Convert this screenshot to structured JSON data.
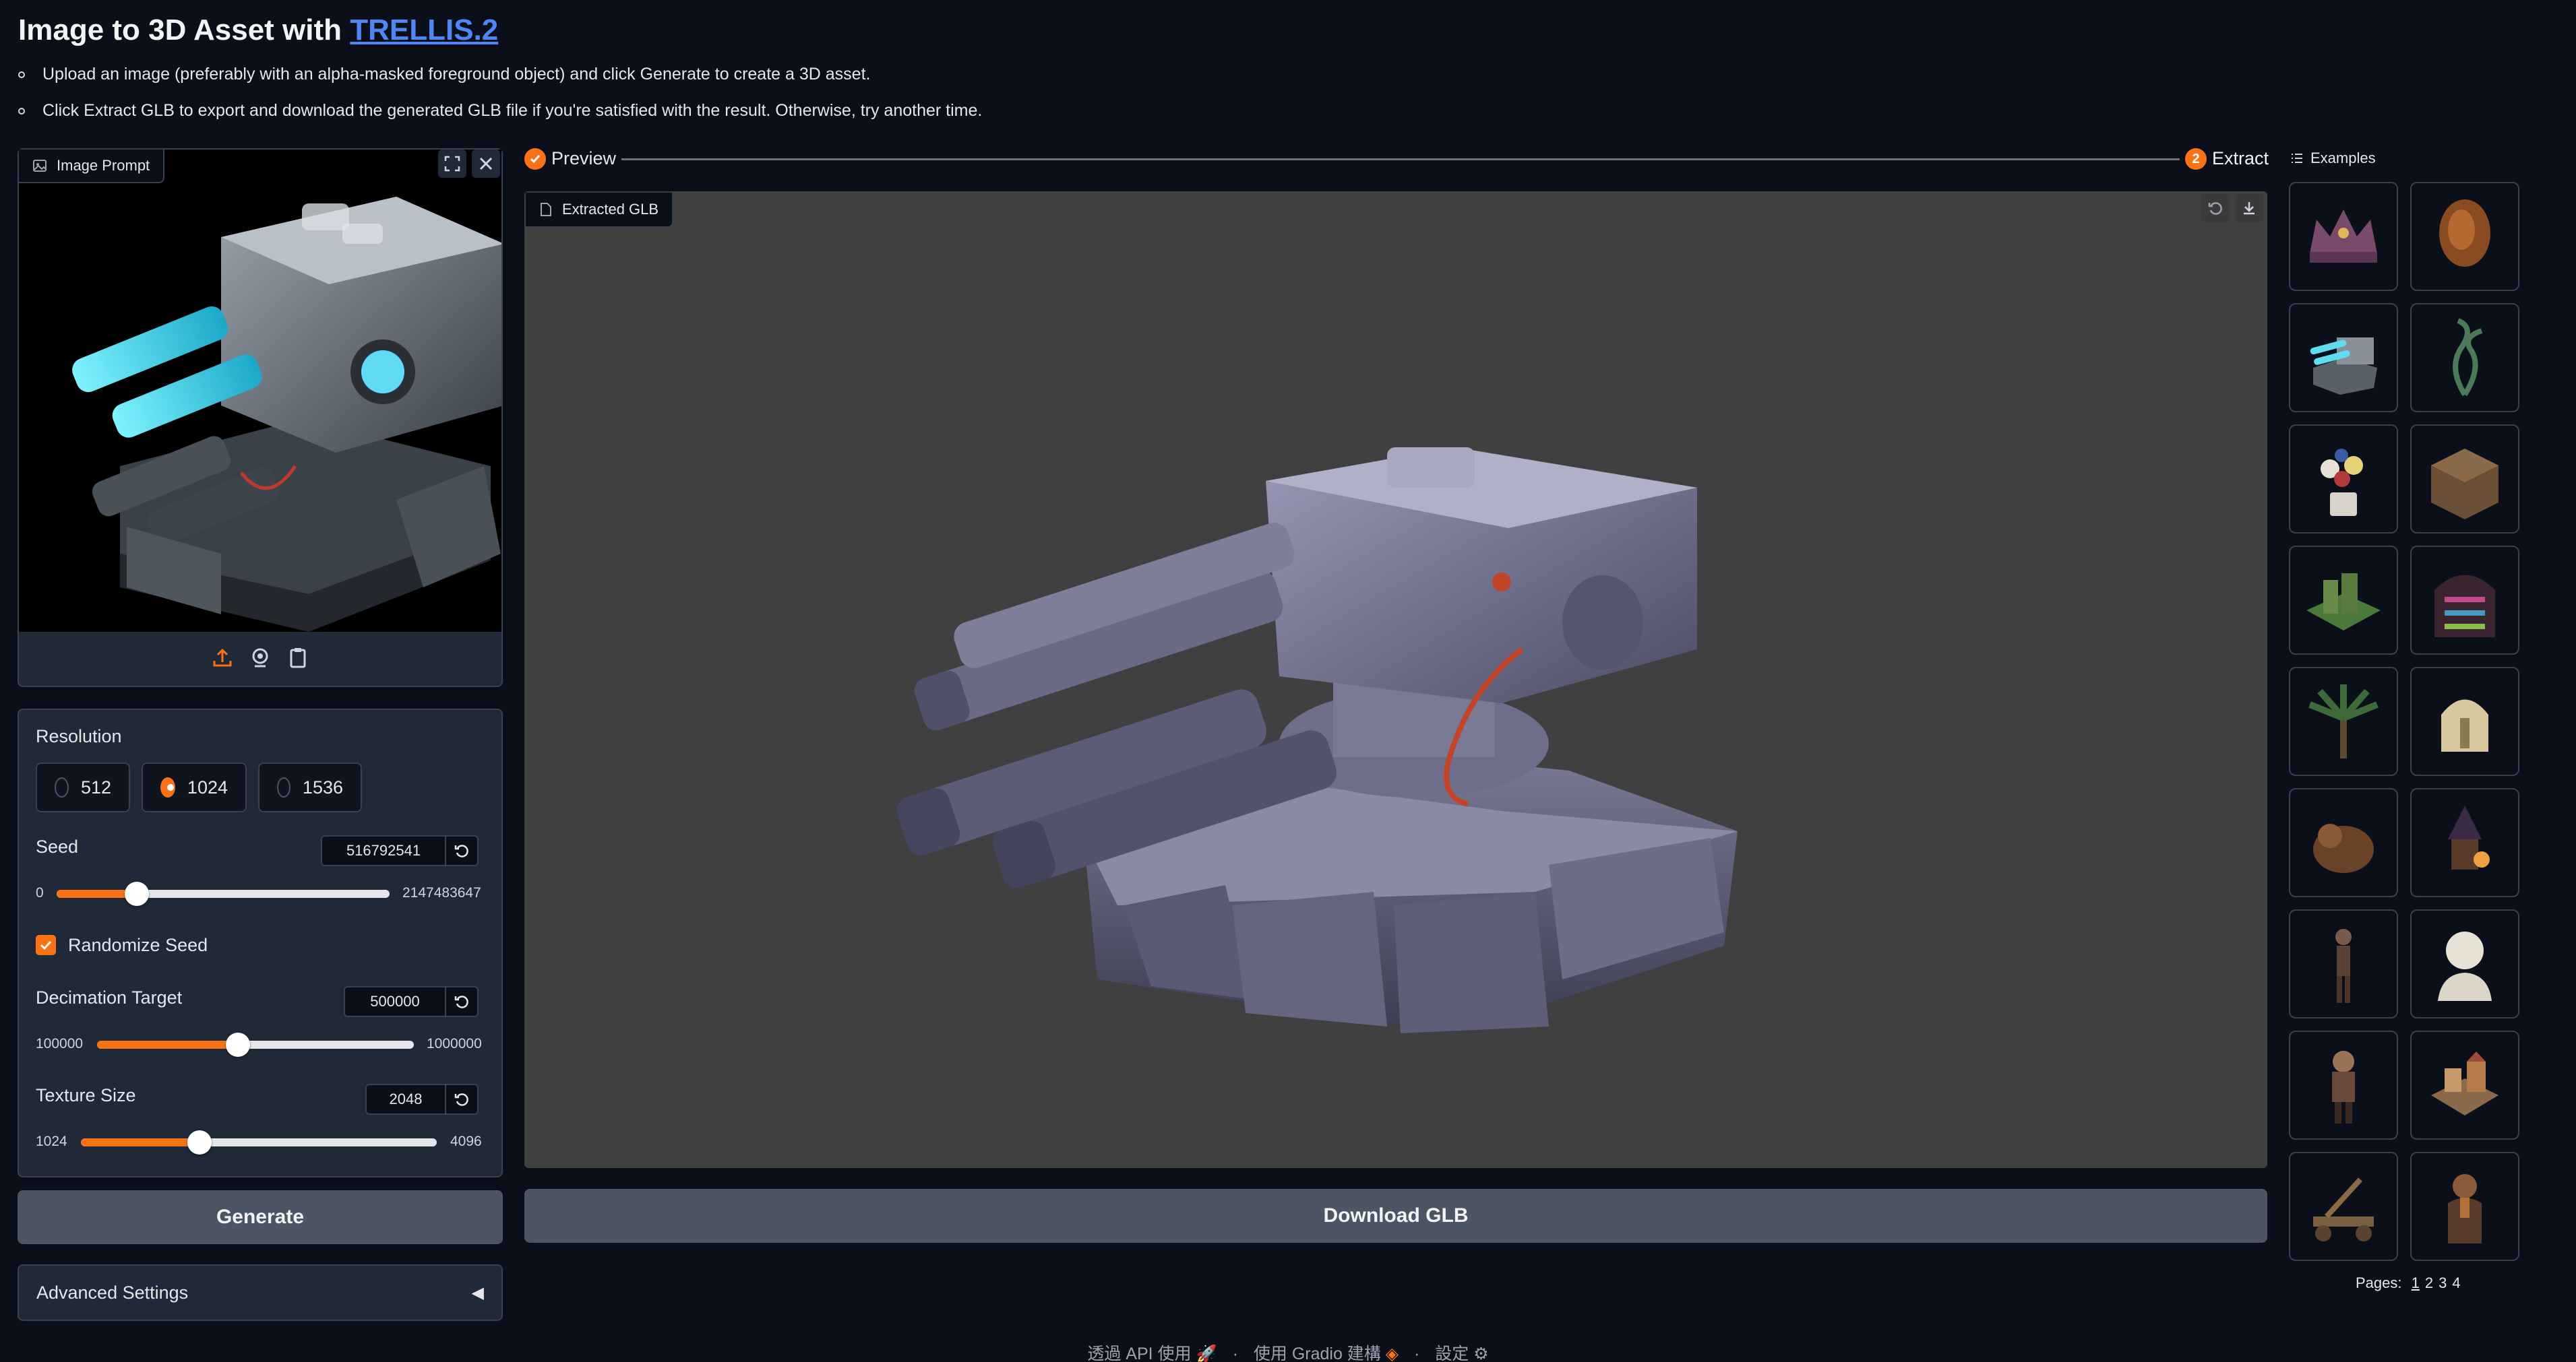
{
  "header": {
    "title_prefix": "Image to 3D Asset with ",
    "title_link": "TRELLIS.2",
    "bullets": [
      "Upload an image (preferably with an alpha-masked foreground object) and click Generate to create a 3D asset.",
      "Click Extract GLB to export and download the generated GLB file if you're satisfied with the result. Otherwise, try another time."
    ]
  },
  "image_prompt": {
    "label": "Image Prompt",
    "toolbar_icons": [
      "upload-icon",
      "webcam-icon",
      "clipboard-icon"
    ]
  },
  "resolution": {
    "label": "Resolution",
    "options": [
      "512",
      "1024",
      "1536"
    ],
    "selected": "1024"
  },
  "seed": {
    "label": "Seed",
    "value": "516792541",
    "min": "0",
    "max": "2147483647",
    "fraction": 0.24
  },
  "randomize_seed": {
    "label": "Randomize Seed",
    "checked": true
  },
  "decimation": {
    "label": "Decimation Target",
    "value": "500000",
    "min": "100000",
    "max": "1000000",
    "fraction": 0.444
  },
  "texture": {
    "label": "Texture Size",
    "value": "2048",
    "min": "1024",
    "max": "4096",
    "fraction": 0.333
  },
  "buttons": {
    "generate": "Generate",
    "download": "Download GLB"
  },
  "advanced": {
    "label": "Advanced Settings",
    "arrow": "◀"
  },
  "stepper": {
    "step1_label": "Preview",
    "step2_number": "2",
    "step2_label": "Extract"
  },
  "viewer": {
    "label": "Extracted GLB"
  },
  "examples": {
    "label": "Examples",
    "pages_label": "Pages:",
    "pages": [
      "1",
      "2",
      "3",
      "4"
    ],
    "thumbnails": [
      "crown",
      "dried-flower",
      "turret",
      "plant-tendrils",
      "flower-pot",
      "diorama-room",
      "city-block",
      "shelf-cabinet",
      "palm-tree",
      "helmet",
      "creature",
      "witch-lantern",
      "figure",
      "bust",
      "warrior",
      "village",
      "catapult",
      "dwarf"
    ]
  },
  "footer": {
    "api": "透過 API 使用",
    "built": "使用 Gradio 建構",
    "settings": "設定",
    "separator": "·"
  },
  "colors": {
    "accent": "#f97316",
    "link": "#4f86f7",
    "background": "#0b0f19",
    "panel": "#1f2937",
    "viewer_bg": "#404040"
  }
}
